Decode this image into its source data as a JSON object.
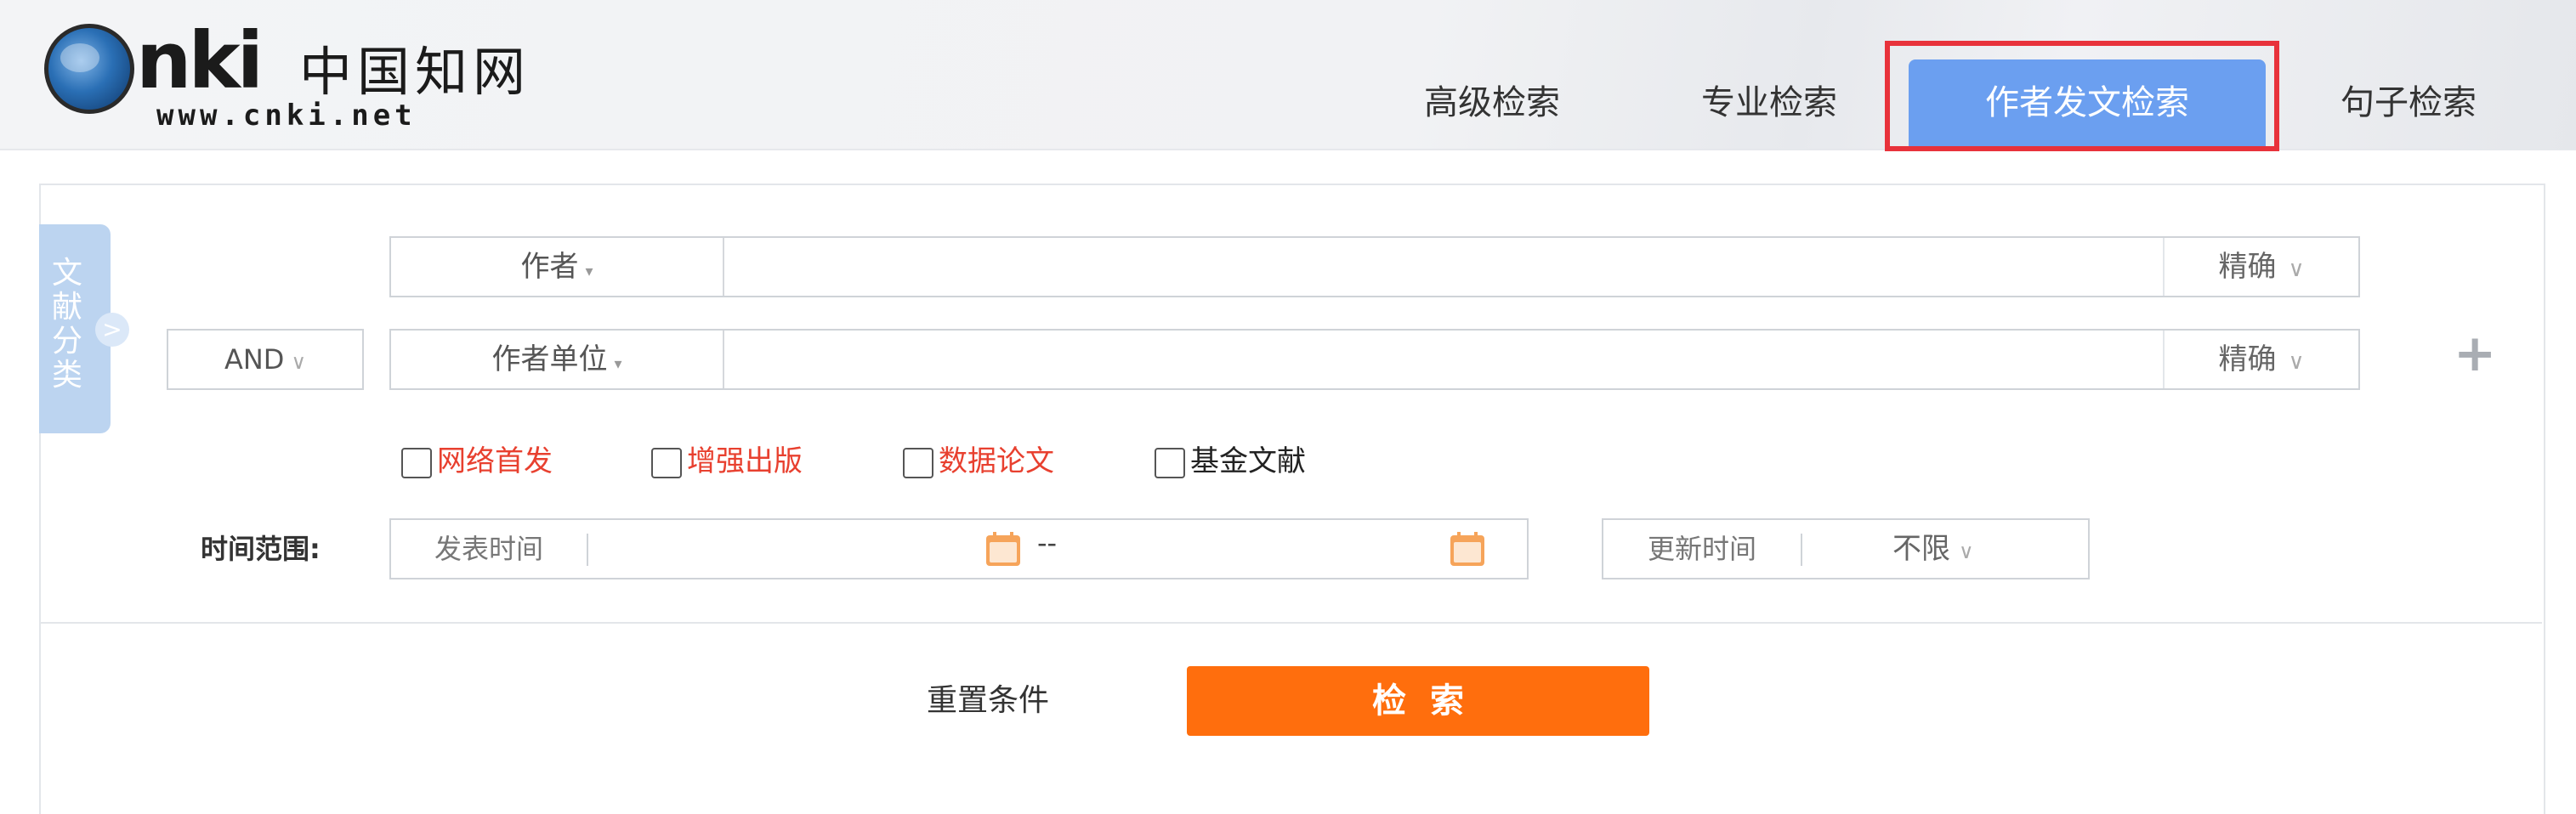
{
  "logo": {
    "brand": "nki",
    "chinese": "中国知网",
    "url": "www.cnki.net"
  },
  "tabs": [
    {
      "label": "高级检索"
    },
    {
      "label": "专业检索"
    },
    {
      "label": "作者发文检索",
      "active": true
    },
    {
      "label": "句子检索"
    }
  ],
  "sidebar": {
    "label_chars": [
      "文",
      "献",
      "分",
      "类"
    ],
    "arrow": ">"
  },
  "search_rows": [
    {
      "field": "作者",
      "match": "精确",
      "logic": ""
    },
    {
      "field": "作者单位",
      "match": "精确",
      "logic": "AND"
    }
  ],
  "add_row_icon": "plus-icon",
  "checkboxes": [
    {
      "label": "网络首发",
      "checked": false
    },
    {
      "label": "增强出版",
      "checked": false
    },
    {
      "label": "数据论文",
      "checked": false
    },
    {
      "label": "基金文献",
      "checked": false
    }
  ],
  "time_range": {
    "label": "时间范围:",
    "publish_label": "发表时间",
    "separator": "--",
    "update_label": "更新时间",
    "update_value": "不限"
  },
  "actions": {
    "reset_label": "重置条件",
    "search_label": "检索"
  },
  "colors": {
    "active_tab": "#6b9ff0",
    "highlight_box": "#e8323b",
    "search_button": "#ff6e0d",
    "checkbox_text_red": "#e8402f",
    "sidebar_tab": "#bcd4f0"
  }
}
